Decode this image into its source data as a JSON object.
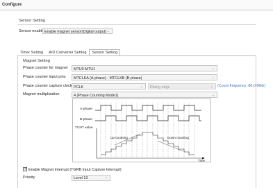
{
  "window": {
    "title": "Configure"
  },
  "sensor_setting_group": {
    "label": "Sensor Setting",
    "sensor_enable_label": "Sensor enable",
    "sensor_enable_value": "Enable magnet sensor(Digital output)"
  },
  "tabs": [
    {
      "label": "Timer Setting"
    },
    {
      "label": "A/D Converter Setting"
    },
    {
      "label": "Sensor Setting"
    }
  ],
  "magnet_setting": {
    "label": "Magnet Setting",
    "phase_counter_label": "Phase counter for magnet",
    "phase_counter_value": "MTU0-MTU1",
    "input_pins_label": "Phase counter input pins",
    "input_pins_value": "MTCLKA (A-phase) - MTCLKB (B-phase)",
    "capture_clock_label": "Phase counter capture clock",
    "capture_clock_value": "PCLK",
    "edge_value": "Rising edge",
    "count_frequency": "(Count frequency: 80.0 MHz)",
    "multiplication_label": "Magnet multiplization",
    "multiplication_value": "4 (Phase Counting Mode1)"
  },
  "diagram": {
    "a_phase": "A-phase",
    "b_phase": "B-phase",
    "tcnt_value": "TCNT value",
    "up_counting": "Up-counting",
    "down_counting": "Down-counting",
    "time": "Time"
  },
  "interrupt": {
    "checkbox_label": "Enable Magnet Interrupt (TGRB Input Capture Interrupt)",
    "checked": true,
    "priority_label": "Priority",
    "priority_value": "Level 13"
  }
}
